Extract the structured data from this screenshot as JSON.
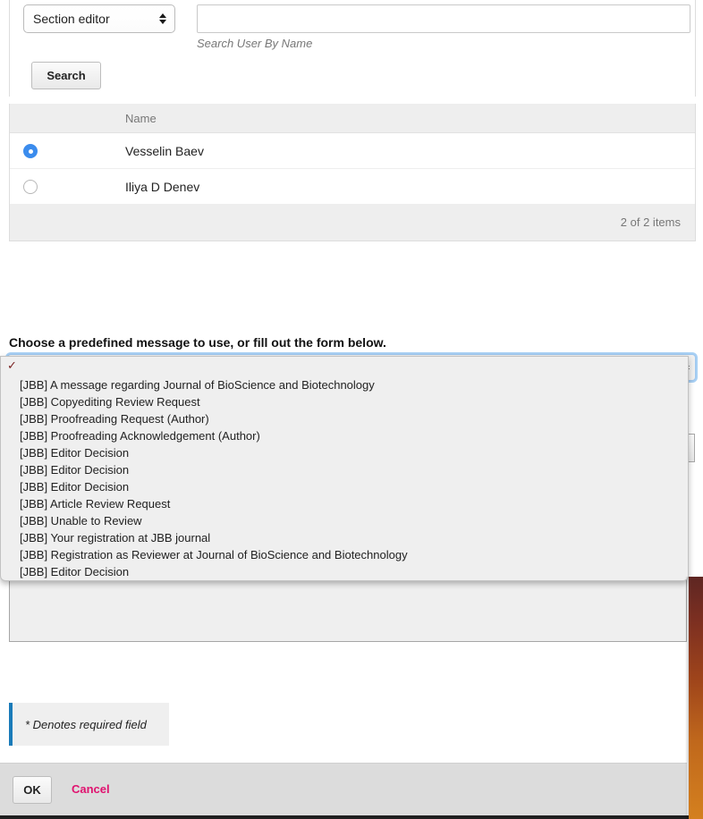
{
  "search": {
    "role_selected": "Section editor",
    "name_value": "",
    "name_placeholder": "",
    "hint": "Search User By Name",
    "search_button": "Search"
  },
  "results_table": {
    "columns": [
      "",
      "Name"
    ],
    "rows": [
      {
        "name": "Vesselin Baev",
        "selected": true
      },
      {
        "name": "Iliya D Denev",
        "selected": false
      }
    ],
    "count_label": "2 of 2 items"
  },
  "predefined": {
    "prompt": "Choose a predefined message to use, or fill out the form below.",
    "selected_value": "",
    "check_glyph": "✓",
    "options": [
      "[JBB] A message regarding Journal of BioScience and Biotechnology",
      "[JBB] Copyediting Review Request",
      "[JBB] Proofreading Request (Author)",
      "[JBB] Proofreading Acknowledgement (Author)",
      "[JBB] Editor Decision",
      "[JBB] Editor Decision",
      "[JBB] Editor Decision",
      "[JBB] Article Review Request",
      "[JBB] Unable to Review",
      "[JBB] Your registration at JBB journal",
      "[JBB] Registration as Reviewer at Journal of BioScience and Biotechnology",
      "[JBB] Editor Decision"
    ]
  },
  "required_note": "* Denotes required field",
  "footer": {
    "ok_label": "OK",
    "cancel_label": "Cancel",
    "cancel_color": "#e0126f"
  }
}
